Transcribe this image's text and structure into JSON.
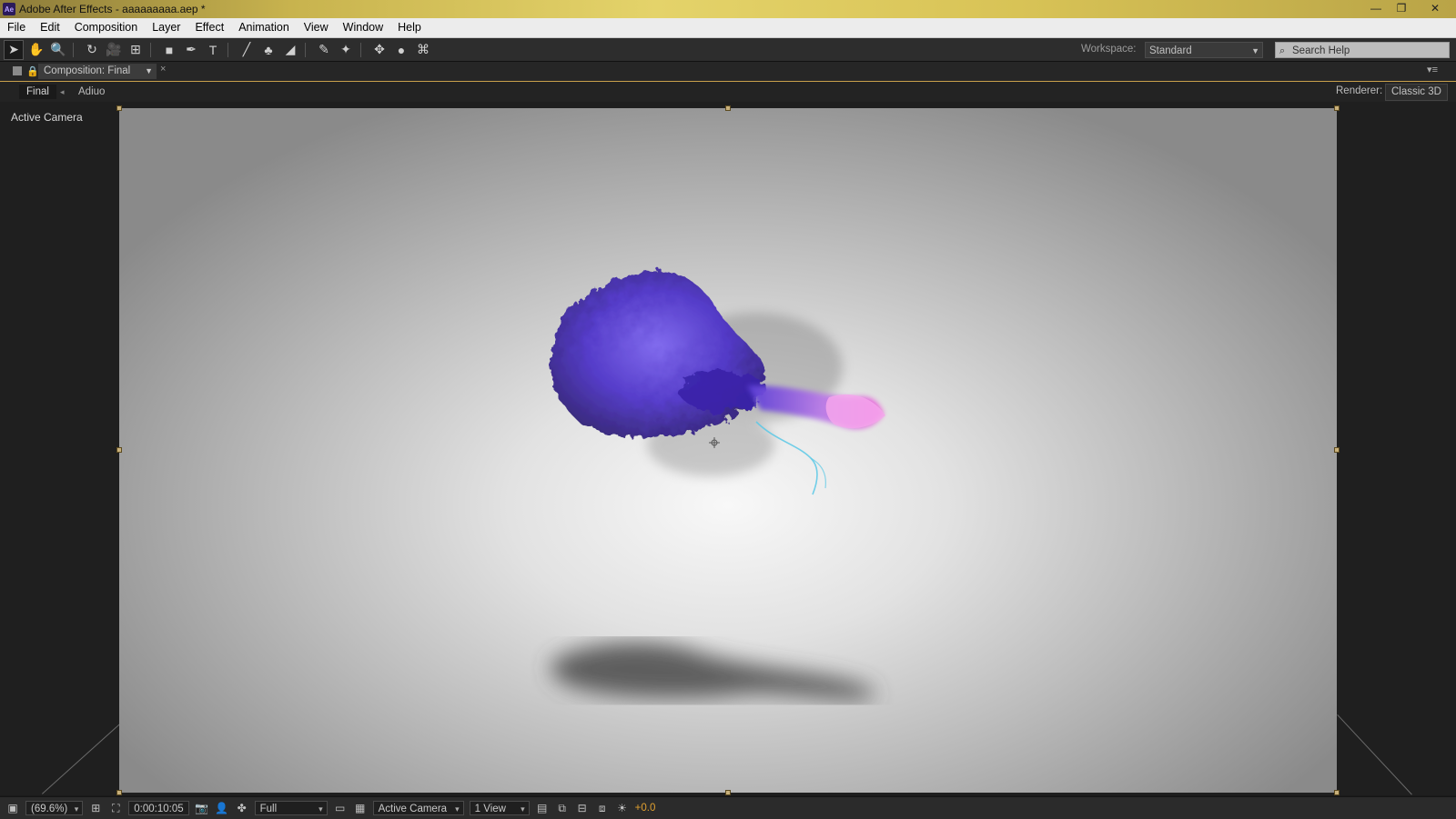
{
  "window": {
    "app_logo": "Ae",
    "title": "Adobe After Effects - aaaaaaaaa.aep *",
    "controls": {
      "minimize": "—",
      "maximize": "❐",
      "close": "✕"
    }
  },
  "menu": [
    "File",
    "Edit",
    "Composition",
    "Layer",
    "Effect",
    "Animation",
    "View",
    "Window",
    "Help"
  ],
  "toolbar": {
    "tools": [
      {
        "name": "selection-tool-icon",
        "glyph": "➤"
      },
      {
        "name": "hand-tool-icon",
        "glyph": "✋"
      },
      {
        "name": "zoom-tool-icon",
        "glyph": "🔍"
      },
      {
        "name": "rotate-tool-icon",
        "glyph": "↻"
      },
      {
        "name": "camera-tool-icon",
        "glyph": "🎥"
      },
      {
        "name": "pan-behind-tool-icon",
        "glyph": "⊞"
      },
      {
        "name": "rectangle-tool-icon",
        "glyph": "■"
      },
      {
        "name": "pen-tool-icon",
        "glyph": "✒"
      },
      {
        "name": "type-tool-icon",
        "glyph": "T"
      },
      {
        "name": "brush-tool-icon",
        "glyph": "╱"
      },
      {
        "name": "clone-stamp-tool-icon",
        "glyph": "♣"
      },
      {
        "name": "eraser-tool-icon",
        "glyph": "◢"
      },
      {
        "name": "roto-brush-tool-icon",
        "glyph": "✎"
      },
      {
        "name": "puppet-pin-tool-icon",
        "glyph": "✦"
      },
      {
        "name": "axis-mode-icon",
        "glyph": "✥"
      },
      {
        "name": "sphere-icon",
        "glyph": "●"
      },
      {
        "name": "world-axis-icon",
        "glyph": "⌘"
      }
    ],
    "workspace_label": "Workspace:",
    "workspace_value": "Standard",
    "search_placeholder": "Search Help"
  },
  "panel": {
    "tab_title": "Composition: Final",
    "close": "×",
    "menu_glyph": "▾≡",
    "breadcrumbs": [
      "Final",
      "Adiuo"
    ],
    "renderer_label": "Renderer:",
    "renderer_value": "Classic 3D"
  },
  "viewer": {
    "view_label": "Active Camera"
  },
  "viewer_controls": {
    "magnification": "(69.6%)",
    "timecode": "0:00:10:05",
    "resolution": "Full",
    "camera": "Active Camera",
    "views": "1 View",
    "exposure": "+0.0"
  },
  "colors": {
    "accent_tab_border": "#c8a04b",
    "exposure_text": "#e0a030",
    "smoke_purple": "#5a3ed6",
    "tail_pink": "#f05ad8",
    "tendril_cyan": "#59c8e6"
  }
}
